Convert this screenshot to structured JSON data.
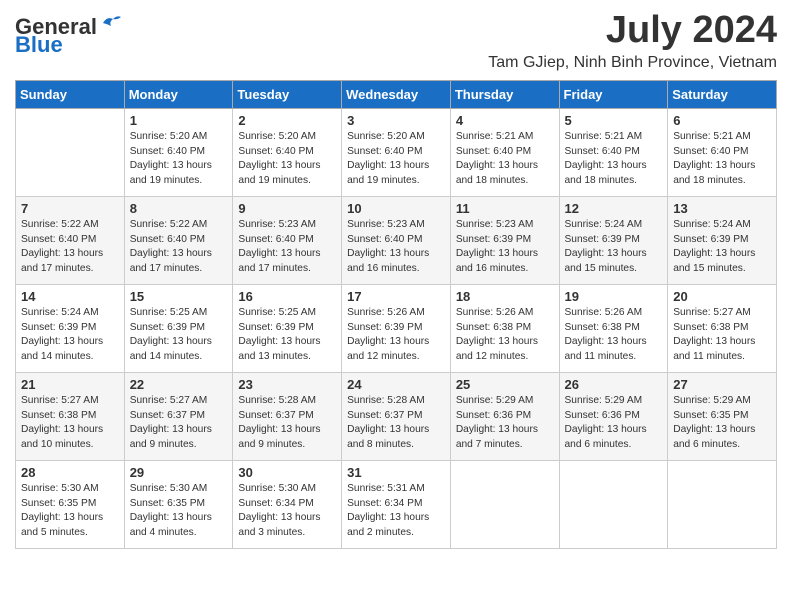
{
  "logo": {
    "general": "General",
    "blue": "Blue"
  },
  "header": {
    "month": "July 2024",
    "location": "Tam GJiep, Ninh Binh Province, Vietnam"
  },
  "weekdays": [
    "Sunday",
    "Monday",
    "Tuesday",
    "Wednesday",
    "Thursday",
    "Friday",
    "Saturday"
  ],
  "weeks": [
    [
      {
        "day": "",
        "sunrise": "",
        "sunset": "",
        "daylight": ""
      },
      {
        "day": "1",
        "sunrise": "Sunrise: 5:20 AM",
        "sunset": "Sunset: 6:40 PM",
        "daylight": "Daylight: 13 hours and 19 minutes."
      },
      {
        "day": "2",
        "sunrise": "Sunrise: 5:20 AM",
        "sunset": "Sunset: 6:40 PM",
        "daylight": "Daylight: 13 hours and 19 minutes."
      },
      {
        "day": "3",
        "sunrise": "Sunrise: 5:20 AM",
        "sunset": "Sunset: 6:40 PM",
        "daylight": "Daylight: 13 hours and 19 minutes."
      },
      {
        "day": "4",
        "sunrise": "Sunrise: 5:21 AM",
        "sunset": "Sunset: 6:40 PM",
        "daylight": "Daylight: 13 hours and 18 minutes."
      },
      {
        "day": "5",
        "sunrise": "Sunrise: 5:21 AM",
        "sunset": "Sunset: 6:40 PM",
        "daylight": "Daylight: 13 hours and 18 minutes."
      },
      {
        "day": "6",
        "sunrise": "Sunrise: 5:21 AM",
        "sunset": "Sunset: 6:40 PM",
        "daylight": "Daylight: 13 hours and 18 minutes."
      }
    ],
    [
      {
        "day": "7",
        "sunrise": "Sunrise: 5:22 AM",
        "sunset": "Sunset: 6:40 PM",
        "daylight": "Daylight: 13 hours and 17 minutes."
      },
      {
        "day": "8",
        "sunrise": "Sunrise: 5:22 AM",
        "sunset": "Sunset: 6:40 PM",
        "daylight": "Daylight: 13 hours and 17 minutes."
      },
      {
        "day": "9",
        "sunrise": "Sunrise: 5:23 AM",
        "sunset": "Sunset: 6:40 PM",
        "daylight": "Daylight: 13 hours and 17 minutes."
      },
      {
        "day": "10",
        "sunrise": "Sunrise: 5:23 AM",
        "sunset": "Sunset: 6:40 PM",
        "daylight": "Daylight: 13 hours and 16 minutes."
      },
      {
        "day": "11",
        "sunrise": "Sunrise: 5:23 AM",
        "sunset": "Sunset: 6:39 PM",
        "daylight": "Daylight: 13 hours and 16 minutes."
      },
      {
        "day": "12",
        "sunrise": "Sunrise: 5:24 AM",
        "sunset": "Sunset: 6:39 PM",
        "daylight": "Daylight: 13 hours and 15 minutes."
      },
      {
        "day": "13",
        "sunrise": "Sunrise: 5:24 AM",
        "sunset": "Sunset: 6:39 PM",
        "daylight": "Daylight: 13 hours and 15 minutes."
      }
    ],
    [
      {
        "day": "14",
        "sunrise": "Sunrise: 5:24 AM",
        "sunset": "Sunset: 6:39 PM",
        "daylight": "Daylight: 13 hours and 14 minutes."
      },
      {
        "day": "15",
        "sunrise": "Sunrise: 5:25 AM",
        "sunset": "Sunset: 6:39 PM",
        "daylight": "Daylight: 13 hours and 14 minutes."
      },
      {
        "day": "16",
        "sunrise": "Sunrise: 5:25 AM",
        "sunset": "Sunset: 6:39 PM",
        "daylight": "Daylight: 13 hours and 13 minutes."
      },
      {
        "day": "17",
        "sunrise": "Sunrise: 5:26 AM",
        "sunset": "Sunset: 6:39 PM",
        "daylight": "Daylight: 13 hours and 12 minutes."
      },
      {
        "day": "18",
        "sunrise": "Sunrise: 5:26 AM",
        "sunset": "Sunset: 6:38 PM",
        "daylight": "Daylight: 13 hours and 12 minutes."
      },
      {
        "day": "19",
        "sunrise": "Sunrise: 5:26 AM",
        "sunset": "Sunset: 6:38 PM",
        "daylight": "Daylight: 13 hours and 11 minutes."
      },
      {
        "day": "20",
        "sunrise": "Sunrise: 5:27 AM",
        "sunset": "Sunset: 6:38 PM",
        "daylight": "Daylight: 13 hours and 11 minutes."
      }
    ],
    [
      {
        "day": "21",
        "sunrise": "Sunrise: 5:27 AM",
        "sunset": "Sunset: 6:38 PM",
        "daylight": "Daylight: 13 hours and 10 minutes."
      },
      {
        "day": "22",
        "sunrise": "Sunrise: 5:27 AM",
        "sunset": "Sunset: 6:37 PM",
        "daylight": "Daylight: 13 hours and 9 minutes."
      },
      {
        "day": "23",
        "sunrise": "Sunrise: 5:28 AM",
        "sunset": "Sunset: 6:37 PM",
        "daylight": "Daylight: 13 hours and 9 minutes."
      },
      {
        "day": "24",
        "sunrise": "Sunrise: 5:28 AM",
        "sunset": "Sunset: 6:37 PM",
        "daylight": "Daylight: 13 hours and 8 minutes."
      },
      {
        "day": "25",
        "sunrise": "Sunrise: 5:29 AM",
        "sunset": "Sunset: 6:36 PM",
        "daylight": "Daylight: 13 hours and 7 minutes."
      },
      {
        "day": "26",
        "sunrise": "Sunrise: 5:29 AM",
        "sunset": "Sunset: 6:36 PM",
        "daylight": "Daylight: 13 hours and 6 minutes."
      },
      {
        "day": "27",
        "sunrise": "Sunrise: 5:29 AM",
        "sunset": "Sunset: 6:35 PM",
        "daylight": "Daylight: 13 hours and 6 minutes."
      }
    ],
    [
      {
        "day": "28",
        "sunrise": "Sunrise: 5:30 AM",
        "sunset": "Sunset: 6:35 PM",
        "daylight": "Daylight: 13 hours and 5 minutes."
      },
      {
        "day": "29",
        "sunrise": "Sunrise: 5:30 AM",
        "sunset": "Sunset: 6:35 PM",
        "daylight": "Daylight: 13 hours and 4 minutes."
      },
      {
        "day": "30",
        "sunrise": "Sunrise: 5:30 AM",
        "sunset": "Sunset: 6:34 PM",
        "daylight": "Daylight: 13 hours and 3 minutes."
      },
      {
        "day": "31",
        "sunrise": "Sunrise: 5:31 AM",
        "sunset": "Sunset: 6:34 PM",
        "daylight": "Daylight: 13 hours and 2 minutes."
      },
      {
        "day": "",
        "sunrise": "",
        "sunset": "",
        "daylight": ""
      },
      {
        "day": "",
        "sunrise": "",
        "sunset": "",
        "daylight": ""
      },
      {
        "day": "",
        "sunrise": "",
        "sunset": "",
        "daylight": ""
      }
    ]
  ]
}
